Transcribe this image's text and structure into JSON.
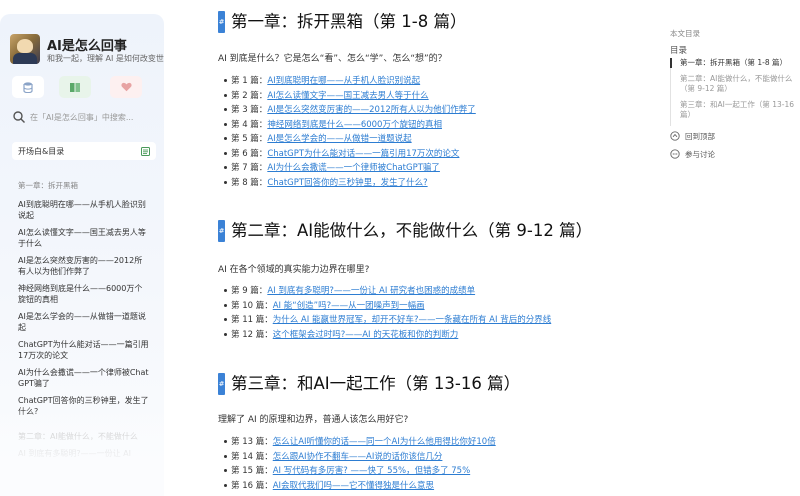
{
  "sidebar": {
    "title": "AI是怎么回事",
    "subtitle": "和我一起，理解 AI 是如何改变世",
    "search_placeholder": "在「AI是怎么回事」中搜索...",
    "nav_header": "开场白&目录",
    "nav_chapter": "第一章：拆开黑箱",
    "nav_items": [
      "AI到底聪明在哪——从手机人脸识别说起",
      "AI怎么读懂文字——国王减去男人等于什么",
      "AI是怎么突然变厉害的——2012所有人以为他们作弊了",
      "神经网络到底是什么——6000万个旋钮的真相",
      "AI是怎么学会的——从做错一道题说起",
      "ChatGPT为什么能对话——一篇引用17万次的论文",
      "AI为什么会撒谎——一个律师被ChatGPT骗了",
      "ChatGPT回答你的三秒钟里，发生了什么?"
    ],
    "nav_faded": [
      "第二章：AI能做什么，不能做什么",
      "AI 到底有多聪明?——一份让 AI"
    ]
  },
  "chapters": [
    {
      "title": "第一章：拆开黑箱（第 1-8 篇）",
      "intro": "AI 到底是什么？它是怎么“看”、怎么“学”、怎么“想”的？",
      "articles": [
        {
          "num": "第 1 篇：",
          "title": "AI到底聪明在哪——从手机人脸识别说起"
        },
        {
          "num": "第 2 篇：",
          "title": "AI怎么读懂文字——国王减去男人等于什么"
        },
        {
          "num": "第 3 篇：",
          "title": "AI是怎么突然变厉害的——2012所有人以为他们作弊了"
        },
        {
          "num": "第 4 篇：",
          "title": "神经网络到底是什么——6000万个旋钮的真相"
        },
        {
          "num": "第 5 篇：",
          "title": "AI是怎么学会的——从做错一道题说起"
        },
        {
          "num": "第 6 篇：",
          "title": "ChatGPT为什么能对话——一篇引用17万次的论文"
        },
        {
          "num": "第 7 篇：",
          "title": "AI为什么会撒谎——一个律师被ChatGPT骗了"
        },
        {
          "num": "第 8 篇：",
          "title": "ChatGPT回答你的三秒钟里，发生了什么?"
        }
      ]
    },
    {
      "title": "第二章：AI能做什么，不能做什么（第 9-12 篇）",
      "intro": "AI 在各个领域的真实能力边界在哪里?",
      "articles": [
        {
          "num": "第 9 篇：",
          "title": "AI 到底有多聪明?——一份让 AI 研究者也困惑的成绩单"
        },
        {
          "num": "第 10 篇：",
          "title": "AI 能“创造”吗?——从一团噪声到一幅画"
        },
        {
          "num": "第 11 篇：",
          "title": "为什么 AI 能赢世界冠军，却开不好车?——一条藏在所有 AI 背后的分界线"
        },
        {
          "num": "第 12 篇：",
          "title": "这个框架会过时吗?——AI 的天花板和你的判断力"
        }
      ]
    },
    {
      "title": "第三章：和AI一起工作（第 13-16 篇）",
      "intro": "理解了 AI 的原理和边界，普通人该怎么用好它?",
      "articles": [
        {
          "num": "第 13 篇：",
          "title": "怎么让AI听懂你的话——同一个AI为什么他用得比你好10倍"
        },
        {
          "num": "第 14 篇：",
          "title": "怎么跟AI协作不翻车——AI说的话你该信几分"
        },
        {
          "num": "第 15 篇：",
          "title": "AI 写代码有多厉害? ——快了 55%，但错多了 75%"
        },
        {
          "num": "第 16 篇：",
          "title": "AI会取代我们吗——它不懂得独是什么意思"
        }
      ]
    }
  ],
  "toc": {
    "label": "本文目录",
    "root": "目录",
    "items": [
      "第一章：拆开黑箱（第 1-8 篇）",
      "第二章：AI能做什么，不能做什么（第 9-12 篇）",
      "第三章：和AI一起工作（第 13-16 篇）"
    ],
    "back_top": "回到顶部",
    "discuss": "参与讨论"
  },
  "colors": {
    "accent": "#3b82d6",
    "link": "#2d7dd2"
  }
}
